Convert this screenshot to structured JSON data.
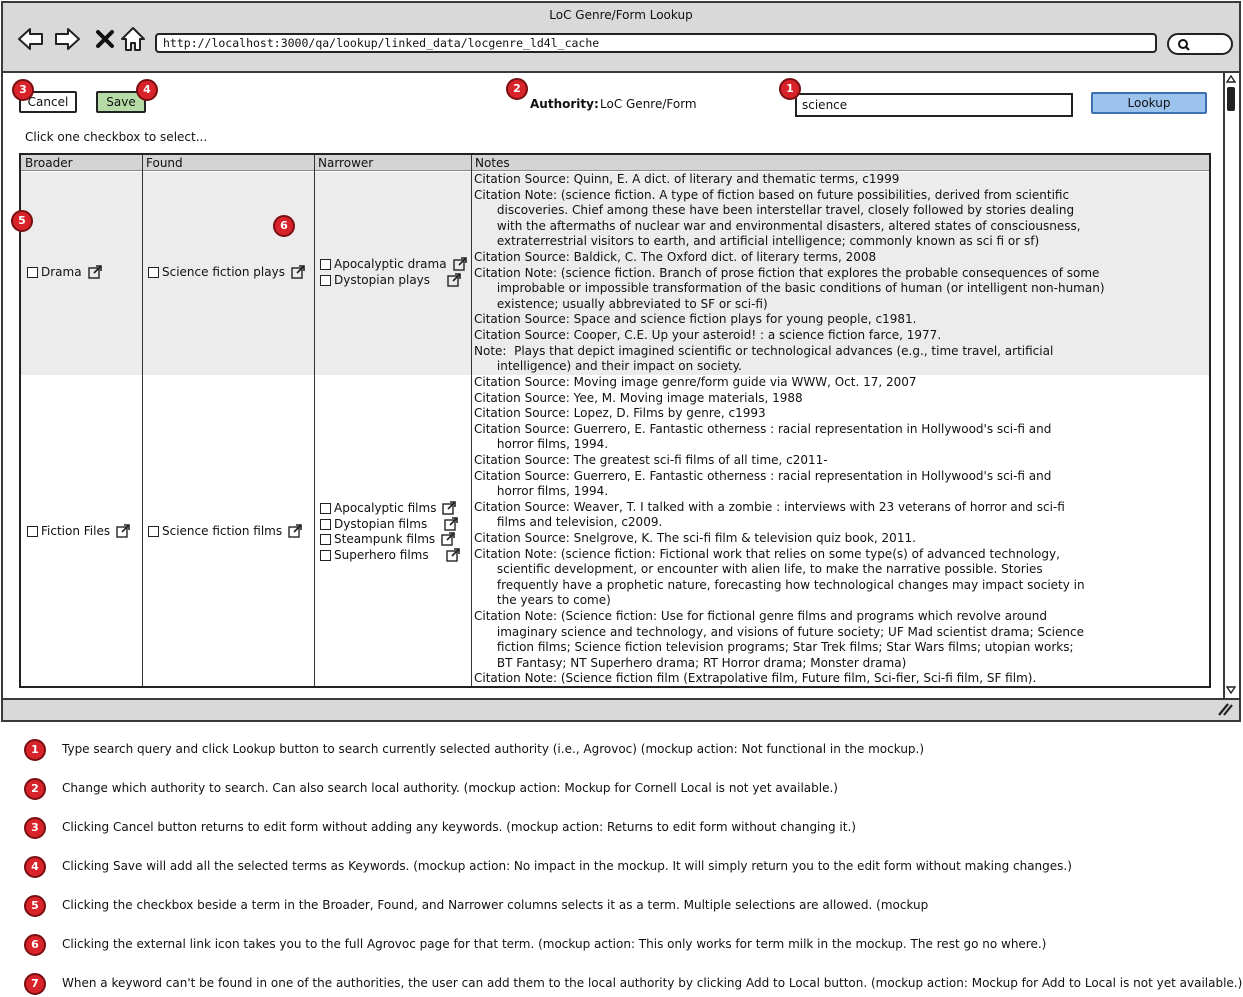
{
  "window": {
    "title": "LoC Genre/Form Lookup"
  },
  "browser": {
    "url": "http://localhost:3000/qa/lookup/linked_data/locgenre_ld4l_cache"
  },
  "toolbar": {
    "cancel_label": "Cancel",
    "save_label": "Save",
    "authority_label": "Authority:",
    "authority_value": "LoC Genre/Form",
    "query_value": "science",
    "lookup_label": "Lookup"
  },
  "instructions": "Click one checkbox to select...",
  "table": {
    "headers": [
      "Broader",
      "Found",
      "Narrower",
      "Notes"
    ],
    "rows": [
      {
        "broader": "Drama",
        "found": "Science fiction plays",
        "narrower": [
          "Apocalyptic drama",
          "Dystopian plays"
        ],
        "notes": [
          "Citation Source: Quinn, E. A dict. of literary and thematic terms, c1999",
          "Citation Note: (science fiction. A type of fiction based on future possibilities, derived from scientific",
          "      discoveries. Chief among these have been interstellar travel, closely followed by stories dealing",
          "      with the aftermaths of nuclear war and environmental disasters, altered states of consciousness,",
          "      extraterrestrial visitors to earth, and artificial intelligence; commonly known as sci fi or sf)",
          "Citation Source: Baldick, C. The Oxford dict. of literary terms, 2008",
          "Citation Note: (science fiction. Branch of prose fiction that explores the probable consequences of some",
          "      improbable or impossible transformation of the basic conditions of human (or intelligent non-human)",
          "      existence; usually abbreviated to SF or sci-fi)",
          "Citation Source: Space and science fiction plays for young people, c1981.",
          "Citation Source: Cooper, C.E. Up your asteroid! : a science fiction farce, 1977.",
          "Note:  Plays that depict imagined scientific or technological advances (e.g., time travel, artificial",
          "      intelligence) and their impact on society."
        ]
      },
      {
        "broader": "Fiction Files",
        "found": "Science fiction films",
        "narrower": [
          "Apocalyptic films",
          "Dystopian films",
          "Steampunk films",
          "Superhero films"
        ],
        "notes": [
          "Citation Source: Moving image genre/form guide via WWW, Oct. 17, 2007",
          "Citation Source: Yee, M. Moving image materials, 1988",
          "Citation Source: Lopez, D. Films by genre, c1993",
          "Citation Source: Guerrero, E. Fantastic otherness : racial representation in Hollywood's sci-fi and",
          "      horror films, 1994.",
          "Citation Source: The greatest sci-fi films of all time, c2011-",
          "Citation Source: Guerrero, E. Fantastic otherness : racial representation in Hollywood's sci-fi and",
          "      horror films, 1994.",
          "Citation Source: Weaver, T. I talked with a zombie : interviews with 23 veterans of horror and sci-fi",
          "      films and television, c2009.",
          "Citation Source: Snelgrove, K. The sci-fi film & television quiz book, 2011.",
          "Citation Note: (science fiction: Fictional work that relies on some type(s) of advanced technology,",
          "      scientific development, or encounter with alien life, to make the narrative possible. Stories",
          "      frequently have a prophetic nature, forecasting how technological changes may impact society in",
          "      the years to come)",
          "Citation Note: (Science fiction: Use for fictional genre films and programs which revolve around",
          "      imaginary science and technology, and visions of future society; UF Mad scientist drama; Science",
          "      fiction films; Science fiction television programs; Star Trek films; Star Wars films; utopian works;",
          "      BT Fantasy; NT Superhero drama; RT Horror drama; Monster drama)",
          "Citation Note: (Science fiction film (Extrapolative film, Future film, Sci-fier, Sci-fi film, SF film)."
        ]
      }
    ]
  },
  "badges": [
    "1",
    "2",
    "3",
    "4",
    "5",
    "6",
    "7"
  ],
  "legend": [
    {
      "num": "1",
      "text": "Type search query and click Lookup button to search currently selected authority (i.e., Agrovoc)  (mockup action: Not functional in the mockup.)"
    },
    {
      "num": "2",
      "text": "Change which authority to search.  Can also search local authority.  (mockup action: Mockup for Cornell Local is not yet available.)"
    },
    {
      "num": "3",
      "text": "Clicking Cancel button returns to edit form without adding any keywords.  (mockup action: Returns to edit form without changing it.)"
    },
    {
      "num": "4",
      "text": "Clicking Save will add all the selected terms as Keywords.  (mockup action: No impact in the mockup.  It will simply return you to the edit form without making changes.)"
    },
    {
      "num": "5",
      "text": "Clicking the checkbox beside a term in the Broader, Found, and Narrower columns selects it as a term.  Multiple selections are allowed.  (mockup"
    },
    {
      "num": "6",
      "text": "Clicking the external link icon takes you to the full Agrovoc page for that term.  (mockup action: This only works for term milk in the mockup.  The rest go no where.)"
    },
    {
      "num": "7",
      "text": "When a keyword can't be found in one of the authorities, the user can add them to the local authority by clicking Add to Local button. (mockup action: Mockup for Add to Local is not yet available.)"
    }
  ]
}
